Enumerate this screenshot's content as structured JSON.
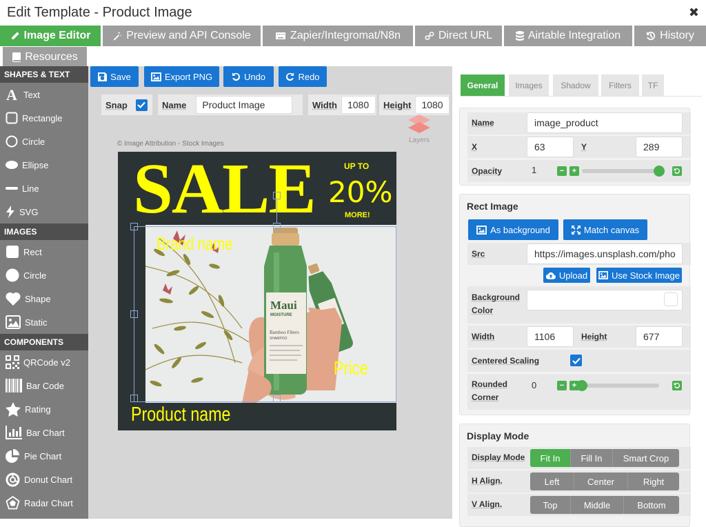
{
  "window": {
    "title": "Edit Template - Product Image",
    "close_symbol": "✖"
  },
  "main_tabs": [
    {
      "label": "Image Editor",
      "icon": "pencil-icon",
      "active": true
    },
    {
      "label": "Preview and API Console",
      "icon": "magic-wand-icon"
    },
    {
      "label": "Zapier/Integromat/N8n",
      "icon": "keyboard-icon"
    },
    {
      "label": "Direct URL",
      "icon": "link-icon"
    },
    {
      "label": "Airtable Integration",
      "icon": "database-icon"
    },
    {
      "label": "History",
      "icon": "history-icon"
    },
    {
      "label": "Resources",
      "icon": "book-icon"
    }
  ],
  "sidebar": {
    "sections": [
      {
        "title": "SHAPES & TEXT",
        "items": [
          {
            "label": "Text",
            "icon": "text-icon"
          },
          {
            "label": "Rectangle",
            "icon": "rectangle-icon"
          },
          {
            "label": "Circle",
            "icon": "circle-icon"
          },
          {
            "label": "Ellipse",
            "icon": "ellipse-icon"
          },
          {
            "label": "Line",
            "icon": "line-icon"
          },
          {
            "label": "SVG",
            "icon": "bolt-icon"
          }
        ]
      },
      {
        "title": "IMAGES",
        "items": [
          {
            "label": "Rect",
            "icon": "rect-image-icon"
          },
          {
            "label": "Circle",
            "icon": "circle-image-icon"
          },
          {
            "label": "Shape",
            "icon": "heart-icon"
          },
          {
            "label": "Static",
            "icon": "static-image-icon"
          }
        ]
      },
      {
        "title": "COMPONENTS",
        "items": [
          {
            "label": "QRCode v2",
            "icon": "qrcode-icon"
          },
          {
            "label": "Bar Code",
            "icon": "barcode-icon"
          },
          {
            "label": "Rating",
            "icon": "star-icon"
          },
          {
            "label": "Bar Chart",
            "icon": "bar-chart-icon"
          },
          {
            "label": "Pie Chart",
            "icon": "pie-chart-icon"
          },
          {
            "label": "Donut Chart",
            "icon": "donut-chart-icon"
          },
          {
            "label": "Radar Chart",
            "icon": "radar-chart-icon"
          }
        ]
      }
    ]
  },
  "toolbar": {
    "save": "Save",
    "export": "Export PNG",
    "undo": "Undo",
    "redo": "Redo"
  },
  "canvas_props": {
    "snap_label": "Snap",
    "snap_checked": true,
    "name_label": "Name",
    "name_value": "Product Image",
    "width_label": "Width",
    "width_value": "1080",
    "height_label": "Height",
    "height_value": "1080",
    "layers_label": "Layers"
  },
  "design": {
    "attribution": "© Image Attribution - Stock Images",
    "sale": "SALE",
    "up_to": "UP TO",
    "percent": "20%",
    "more": "MORE!",
    "brand": "Brand name",
    "price": "Price",
    "product": "Product name",
    "bottle_label_brand": "Maui",
    "bottle_label_sub": "MOISTURE",
    "bottle_label_line": "Bamboo Fibers",
    "bottle_label_type": "SHAMPOO",
    "colors": {
      "background": "#2c3335",
      "text": "#ffff00"
    }
  },
  "right_tabs": [
    "General",
    "Images",
    "Shadow",
    "Filters",
    "TF"
  ],
  "general": {
    "name_label": "Name",
    "name_value": "image_product",
    "x_label": "X",
    "x_value": "63",
    "y_label": "Y",
    "y_value": "289",
    "opacity_label": "Opacity",
    "opacity_value": "1",
    "opacity_fraction": 1
  },
  "rect_image": {
    "title": "Rect Image",
    "as_background": "As background",
    "match_canvas": "Match canvas",
    "src_label": "Src",
    "src_value": "https://images.unsplash.com/pho",
    "upload": "Upload",
    "stock": "Use Stock Image",
    "bg_label": "Background Color",
    "width_label": "Width",
    "width_value": "1106",
    "height_label": "Height",
    "height_value": "677",
    "centered_label": "Centered Scaling",
    "centered_checked": true,
    "rounded_label": "Rounded Corner",
    "rounded_value": "0",
    "rounded_fraction": 0
  },
  "display_mode": {
    "title": "Display Mode",
    "mode_label": "Display Mode",
    "modes": [
      "Fit In",
      "Fill In",
      "Smart Crop"
    ],
    "active_mode": "Fit In",
    "h_label": "H Align.",
    "h_options": [
      "Left",
      "Center",
      "Right"
    ],
    "v_label": "V Align.",
    "v_options": [
      "Top",
      "Middle",
      "Bottom"
    ]
  }
}
